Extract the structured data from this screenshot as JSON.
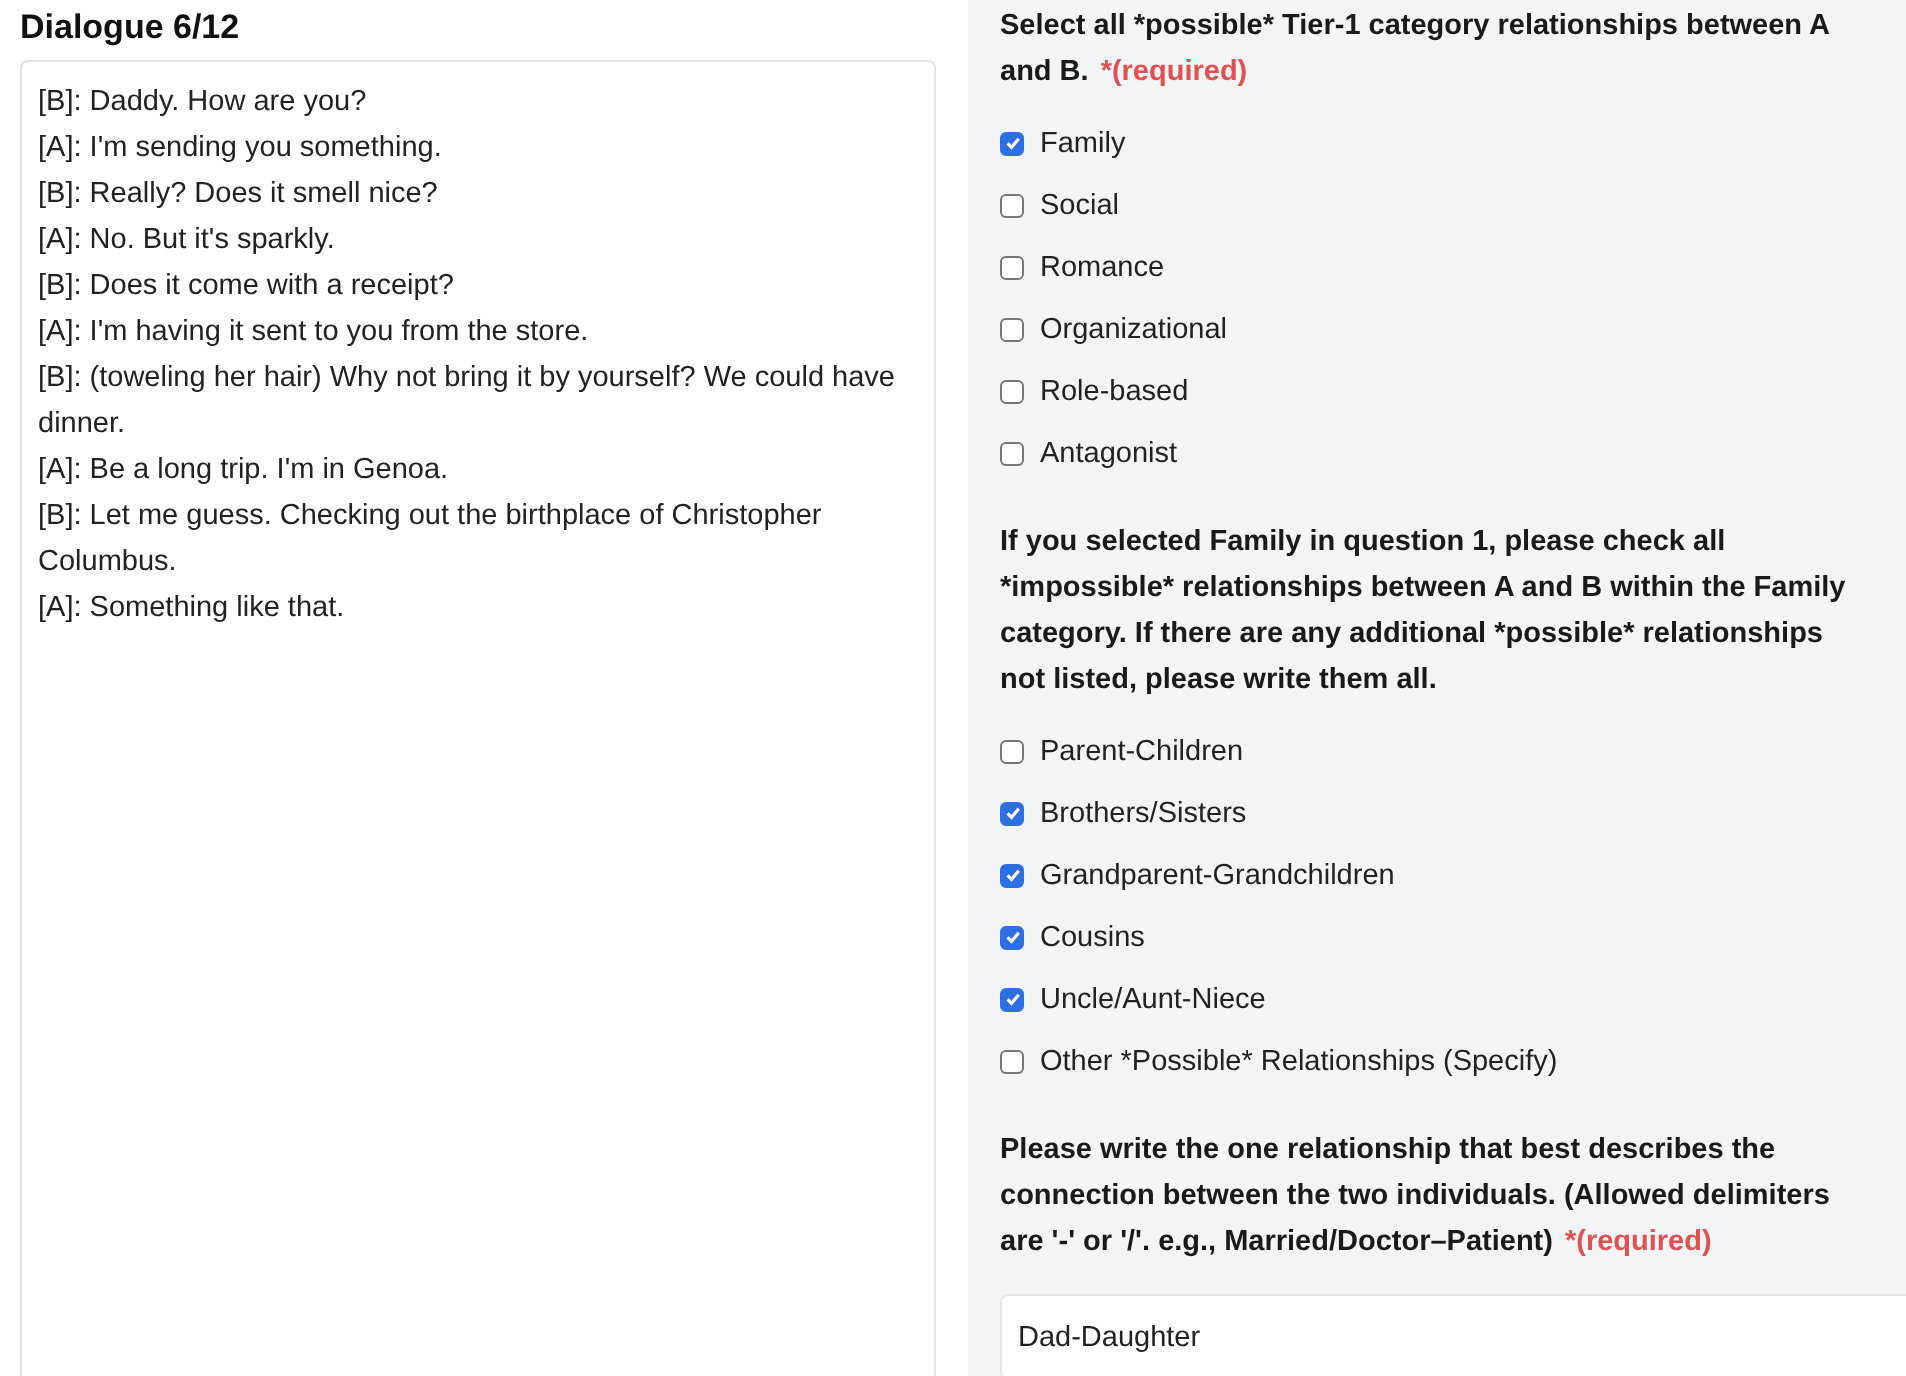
{
  "dialogue": {
    "title": "Dialogue 6/12",
    "lines": [
      "[B]: Daddy. How are you?",
      "[A]: I'm sending you something.",
      "[B]: Really? Does it smell nice?",
      "[A]: No. But it's sparkly.",
      "[B]: Does it come with a receipt?",
      "[A]: I'm having it sent to you from the store.",
      "[B]: (toweling her hair) Why not bring it by yourself? We could have dinner.",
      "[A]: Be a long trip. I'm in Genoa.",
      "[B]: Let me guess. Checking out the birthplace of Christopher Columbus.",
      "[A]: Something like that."
    ]
  },
  "questions": [
    {
      "kind": "checkboxes",
      "text": "Select all *possible* Tier-1 category relationships between A and B.",
      "required": "*(required)",
      "options": [
        {
          "label": "Family",
          "checked": true
        },
        {
          "label": "Social",
          "checked": false
        },
        {
          "label": "Romance",
          "checked": false
        },
        {
          "label": "Organizational",
          "checked": false
        },
        {
          "label": "Role-based",
          "checked": false
        },
        {
          "label": "Antagonist",
          "checked": false
        }
      ]
    },
    {
      "kind": "checkboxes",
      "text": "If you selected Family in question 1, please check all *impossible* relationships between A and B within the Family category. If there are any additional *possible* relationships not listed, please write them all.",
      "options": [
        {
          "label": "Parent-Children",
          "checked": false
        },
        {
          "label": "Brothers/Sisters",
          "checked": true
        },
        {
          "label": "Grandparent-Grandchildren",
          "checked": true
        },
        {
          "label": "Cousins",
          "checked": true
        },
        {
          "label": "Uncle/Aunt-Niece",
          "checked": true
        },
        {
          "label": "Other *Possible* Relationships (Specify)",
          "checked": false
        }
      ]
    },
    {
      "kind": "text",
      "text": "Please write the one relationship that best describes the connection between the two individuals. (Allowed delimiters are '-' or '/'. e.g., Married/Doctor–Patient)",
      "required": "*(required)",
      "value": "Dad-Daughter"
    }
  ]
}
